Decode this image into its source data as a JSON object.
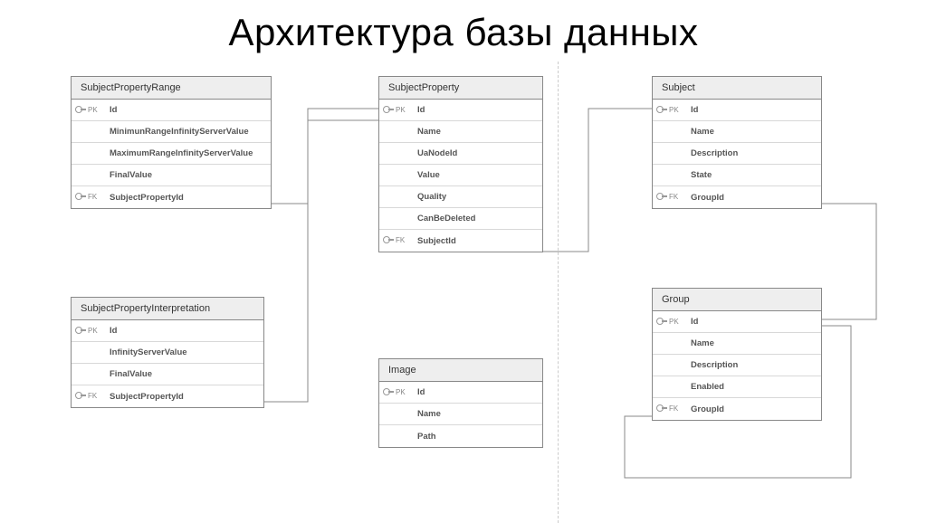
{
  "title": "Архитектура базы данных",
  "entities": {
    "subjectPropertyRange": {
      "name": "SubjectPropertyRange",
      "fields": [
        {
          "name": "Id",
          "key": "PK"
        },
        {
          "name": "MinimunRangeInfinityServerValue",
          "key": ""
        },
        {
          "name": "MaximumRangeInfinityServerValue",
          "key": ""
        },
        {
          "name": "FinalValue",
          "key": ""
        },
        {
          "name": "SubjectPropertyId",
          "key": "FK"
        }
      ]
    },
    "subjectPropertyInterpretation": {
      "name": "SubjectPropertyInterpretation",
      "fields": [
        {
          "name": "Id",
          "key": "PK"
        },
        {
          "name": "InfinityServerValue",
          "key": ""
        },
        {
          "name": "FinalValue",
          "key": ""
        },
        {
          "name": "SubjectPropertyId",
          "key": "FK"
        }
      ]
    },
    "subjectProperty": {
      "name": "SubjectProperty",
      "fields": [
        {
          "name": "Id",
          "key": "PK"
        },
        {
          "name": "Name",
          "key": ""
        },
        {
          "name": "UaNodeId",
          "key": ""
        },
        {
          "name": "Value",
          "key": ""
        },
        {
          "name": "Quality",
          "key": ""
        },
        {
          "name": "CanBeDeleted",
          "key": ""
        },
        {
          "name": "SubjectId",
          "key": "FK"
        }
      ]
    },
    "image": {
      "name": "Image",
      "fields": [
        {
          "name": "Id",
          "key": "PK"
        },
        {
          "name": "Name",
          "key": ""
        },
        {
          "name": "Path",
          "key": ""
        }
      ]
    },
    "subject": {
      "name": "Subject",
      "fields": [
        {
          "name": "Id",
          "key": "PK"
        },
        {
          "name": "Name",
          "key": ""
        },
        {
          "name": "Description",
          "key": ""
        },
        {
          "name": "State",
          "key": ""
        },
        {
          "name": "GroupId",
          "key": "FK"
        }
      ]
    },
    "group": {
      "name": "Group",
      "fields": [
        {
          "name": "Id",
          "key": "PK"
        },
        {
          "name": "Name",
          "key": ""
        },
        {
          "name": "Description",
          "key": ""
        },
        {
          "name": "Enabled",
          "key": ""
        },
        {
          "name": "GroupId",
          "key": "FK"
        }
      ]
    }
  },
  "chart_data": {
    "type": "table",
    "title": "Архитектура базы данных",
    "description": "Entity-relationship diagram with six tables and foreign-key relationships",
    "tables": [
      {
        "name": "SubjectPropertyRange",
        "columns": [
          {
            "name": "Id",
            "key": "PK"
          },
          {
            "name": "MinimunRangeInfinityServerValue"
          },
          {
            "name": "MaximumRangeInfinityServerValue"
          },
          {
            "name": "FinalValue"
          },
          {
            "name": "SubjectPropertyId",
            "key": "FK",
            "references": "SubjectProperty.Id"
          }
        ]
      },
      {
        "name": "SubjectPropertyInterpretation",
        "columns": [
          {
            "name": "Id",
            "key": "PK"
          },
          {
            "name": "InfinityServerValue"
          },
          {
            "name": "FinalValue"
          },
          {
            "name": "SubjectPropertyId",
            "key": "FK",
            "references": "SubjectProperty.Id"
          }
        ]
      },
      {
        "name": "SubjectProperty",
        "columns": [
          {
            "name": "Id",
            "key": "PK"
          },
          {
            "name": "Name"
          },
          {
            "name": "UaNodeId"
          },
          {
            "name": "Value"
          },
          {
            "name": "Quality"
          },
          {
            "name": "CanBeDeleted"
          },
          {
            "name": "SubjectId",
            "key": "FK",
            "references": "Subject.Id"
          }
        ]
      },
      {
        "name": "Image",
        "columns": [
          {
            "name": "Id",
            "key": "PK"
          },
          {
            "name": "Name"
          },
          {
            "name": "Path"
          }
        ]
      },
      {
        "name": "Subject",
        "columns": [
          {
            "name": "Id",
            "key": "PK"
          },
          {
            "name": "Name"
          },
          {
            "name": "Description"
          },
          {
            "name": "State"
          },
          {
            "name": "GroupId",
            "key": "FK",
            "references": "Group.Id"
          }
        ]
      },
      {
        "name": "Group",
        "columns": [
          {
            "name": "Id",
            "key": "PK"
          },
          {
            "name": "Name"
          },
          {
            "name": "Description"
          },
          {
            "name": "Enabled"
          },
          {
            "name": "GroupId",
            "key": "FK",
            "references": "Group.Id"
          }
        ]
      }
    ],
    "relationships": [
      {
        "from": "SubjectPropertyRange.SubjectPropertyId",
        "to": "SubjectProperty.Id"
      },
      {
        "from": "SubjectPropertyInterpretation.SubjectPropertyId",
        "to": "SubjectProperty.Id"
      },
      {
        "from": "SubjectProperty.SubjectId",
        "to": "Subject.Id"
      },
      {
        "from": "Subject.GroupId",
        "to": "Group.Id"
      },
      {
        "from": "Group.GroupId",
        "to": "Group.Id"
      }
    ]
  }
}
